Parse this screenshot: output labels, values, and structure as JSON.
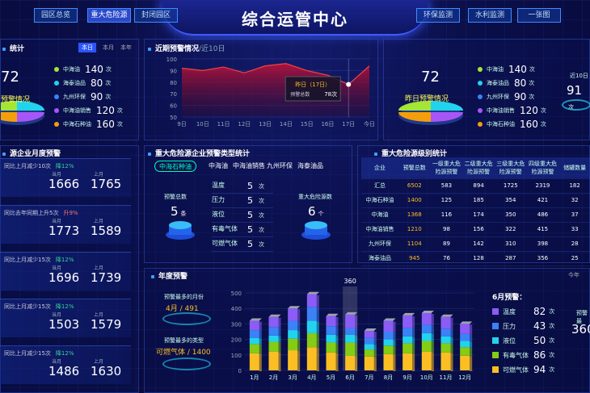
{
  "header": {
    "title": "综合运管中心",
    "nav_left": [
      "园区总览",
      "重大危险源",
      "封闭园区"
    ],
    "nav_right": [
      "环保监测",
      "水利监测",
      "一张图"
    ],
    "active": "重大危险源"
  },
  "left_stats": {
    "title_fragment": "统计",
    "tabs": [
      "本日",
      "本月",
      "本年"
    ],
    "big_number": "72",
    "pie_caption": "预警情况",
    "legend": [
      {
        "label": "中海油",
        "value": "140",
        "unit": "次",
        "color": "#a3e635"
      },
      {
        "label": "海泰油品",
        "value": "80",
        "unit": "次",
        "color": "#22d3ee"
      },
      {
        "label": "九州环保",
        "value": "90",
        "unit": "次",
        "color": "#3b82f6"
      },
      {
        "label": "中海油销售",
        "value": "120",
        "unit": "次",
        "color": "#a855f7"
      },
      {
        "label": "中海石种油",
        "value": "160",
        "unit": "次",
        "color": "#f59e0b"
      }
    ]
  },
  "trend": {
    "title": "近期预警情况",
    "subtitle": "/近10日",
    "y_ticks": [
      "100",
      "90",
      "80",
      "70",
      "60",
      "50"
    ],
    "x_labels": [
      "9日",
      "10日",
      "11日",
      "12日",
      "13日",
      "14日",
      "15日",
      "16日",
      "17日",
      "今日"
    ],
    "tooltip_title": "昨日（17日）",
    "tooltip_label": "预警总数",
    "tooltip_value": "78次"
  },
  "right_stats": {
    "big_number": "72",
    "pie_caption": "昨日预警情况",
    "legend": [
      {
        "label": "中海油",
        "value": "140",
        "unit": "次",
        "color": "#a3e635"
      },
      {
        "label": "海泰油品",
        "value": "80",
        "unit": "次",
        "color": "#22d3ee"
      },
      {
        "label": "九州环保",
        "value": "90",
        "unit": "次",
        "color": "#3b82f6"
      },
      {
        "label": "中海油销售",
        "value": "120",
        "unit": "次",
        "color": "#a855f7"
      },
      {
        "label": "中海石种油",
        "value": "160",
        "unit": "次",
        "color": "#f59e0b"
      }
    ],
    "edge_label": "近10日",
    "edge_value": "91",
    "edge_unit": "次"
  },
  "monthly": {
    "title": "源企业月度预警",
    "cards": [
      {
        "text": "同比上月减少10次",
        "trend": "降12%",
        "cur_label": "当月",
        "prev_label": "上月",
        "cur": "1666",
        "prev": "1765"
      },
      {
        "text": "同比去年同期上升5次",
        "trend": "升9%",
        "cur_label": "当月",
        "prev_label": "上月",
        "cur": "1773",
        "prev": "1589"
      },
      {
        "text": "同比上月减少15次",
        "trend": "降12%",
        "cur_label": "当月",
        "prev_label": "上月",
        "cur": "1696",
        "prev": "1739"
      },
      {
        "text": "同比上月减少15次",
        "trend": "降12%",
        "cur_label": "当月",
        "prev_label": "上月",
        "cur": "1503",
        "prev": "1579"
      },
      {
        "text": "同比上月减少15次",
        "trend": "降12%",
        "cur_label": "当月",
        "prev_label": "上月",
        "cur": "1486",
        "prev": "1630"
      }
    ]
  },
  "types": {
    "title": "重大危险源企业预警类型统计",
    "tabs": [
      "中海石种油",
      "中海油",
      "中海油销售",
      "九州环保",
      "海泰油品"
    ],
    "total_label": "预警总数",
    "total_value": "5",
    "total_unit": "条",
    "source_label": "重大危险源数",
    "source_value": "6",
    "source_unit": "个",
    "rows": [
      {
        "label": "温度",
        "value": "5",
        "unit": "次"
      },
      {
        "label": "压力",
        "value": "5",
        "unit": "次"
      },
      {
        "label": "液位",
        "value": "5",
        "unit": "次"
      },
      {
        "label": "有毒气体",
        "value": "5",
        "unit": "次"
      },
      {
        "label": "可燃气体",
        "value": "5",
        "unit": "次"
      }
    ]
  },
  "levels": {
    "title": "重大危险源级别统计",
    "headers": [
      "企业",
      "预警总数",
      "一级重大危险源预警",
      "二级重大危险源预警",
      "三级重大危险源预警",
      "四级重大危险源预警",
      "储罐数量"
    ],
    "rows": [
      [
        "汇总",
        "6502",
        "583",
        "894",
        "1725",
        "2319",
        "182"
      ],
      [
        "中海石种油",
        "1400",
        "125",
        "185",
        "354",
        "421",
        "32"
      ],
      [
        "中海油",
        "1368",
        "116",
        "174",
        "350",
        "486",
        "37"
      ],
      [
        "中海油销售",
        "1210",
        "98",
        "156",
        "322",
        "415",
        "33"
      ],
      [
        "九州环保",
        "1104",
        "89",
        "142",
        "310",
        "398",
        "28"
      ],
      [
        "海泰油品",
        "945",
        "76",
        "128",
        "287",
        "356",
        "25"
      ]
    ]
  },
  "annual": {
    "title": "年度预警",
    "tab_label": "今年",
    "max_month_label": "预警最多的月份",
    "max_month_value": "4月 / 491",
    "max_type_label": "预警最多的类型",
    "max_type_value": "可燃气体 / 1400",
    "june_title": "6月预警：",
    "june_rows": [
      {
        "label": "温度",
        "value": "82",
        "unit": "次",
        "color": "#8b5cf6"
      },
      {
        "label": "压力",
        "value": "43",
        "unit": "次",
        "color": "#3b82f6"
      },
      {
        "label": "液位",
        "value": "50",
        "unit": "次",
        "color": "#22d3ee"
      },
      {
        "label": "有毒气体",
        "value": "86",
        "unit": "次",
        "color": "#84cc16"
      },
      {
        "label": "可燃气体",
        "value": "94",
        "unit": "次",
        "color": "#fbbf24"
      }
    ],
    "right_edge_label": "预警最",
    "right_edge_value": "360"
  },
  "chart_data": [
    {
      "type": "area",
      "title": "近期预警情况",
      "categories": [
        "9日",
        "10日",
        "11日",
        "12日",
        "13日",
        "14日",
        "15日",
        "16日",
        "17日",
        "今日"
      ],
      "values": [
        92,
        90,
        93,
        88,
        94,
        96,
        90,
        86,
        78,
        94
      ],
      "ylim": [
        50,
        100
      ],
      "color": "#e11d48"
    },
    {
      "type": "bar",
      "title": "年度预警",
      "categories": [
        "1月",
        "2月",
        "3月",
        "4月",
        "5月",
        "6月",
        "7月",
        "8月",
        "9月",
        "10月",
        "11月",
        "12月"
      ],
      "ylim": [
        0,
        500
      ],
      "y_ticks": [
        "500",
        "400",
        "300",
        "200",
        "100",
        "0"
      ],
      "series": [
        {
          "name": "可燃气体",
          "color": "#fbbf24",
          "values": [
            110,
            120,
            130,
            150,
            115,
            94,
            90,
            105,
            110,
            120,
            115,
            95
          ]
        },
        {
          "name": "有毒气体",
          "color": "#84cc16",
          "values": [
            60,
            65,
            75,
            90,
            65,
            86,
            45,
            55,
            65,
            70,
            60,
            55
          ]
        },
        {
          "name": "液位",
          "color": "#22d3ee",
          "values": [
            40,
            40,
            55,
            80,
            50,
            50,
            35,
            40,
            45,
            50,
            45,
            40
          ]
        },
        {
          "name": "压力",
          "color": "#3b82f6",
          "values": [
            50,
            55,
            60,
            90,
            55,
            43,
            40,
            50,
            55,
            55,
            50,
            45
          ]
        },
        {
          "name": "温度",
          "color": "#8b5cf6",
          "values": [
            60,
            65,
            80,
            81,
            65,
            87,
            45,
            70,
            80,
            75,
            75,
            65
          ]
        }
      ],
      "highlight": {
        "category": "6月",
        "label": "360"
      }
    }
  ]
}
